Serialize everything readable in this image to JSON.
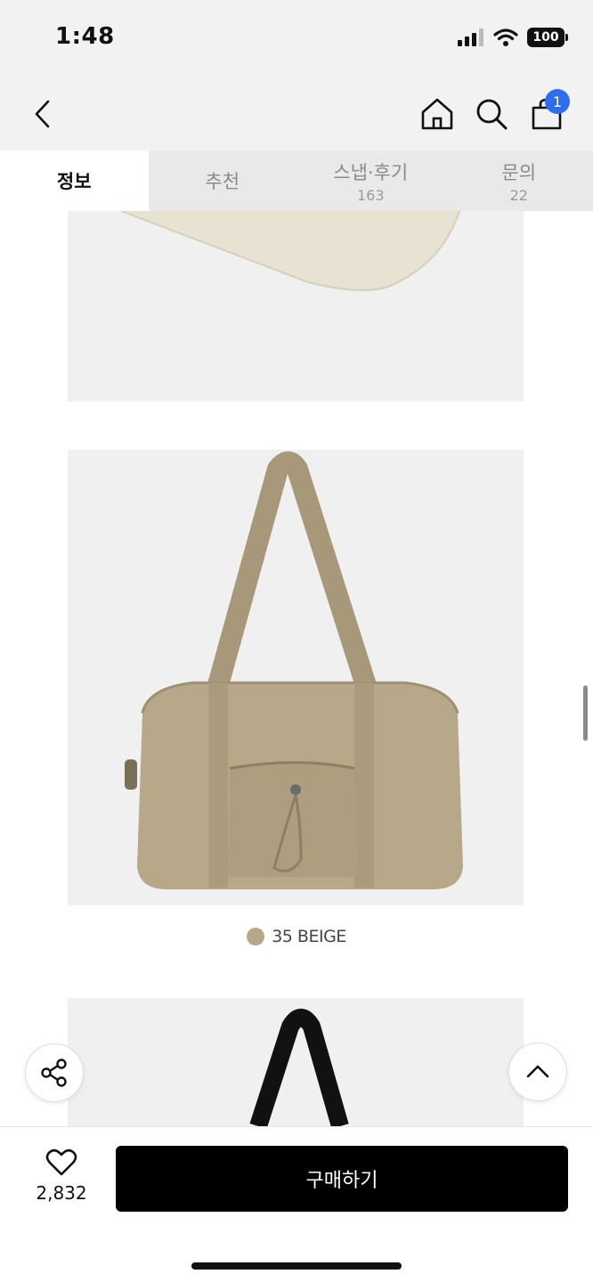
{
  "status": {
    "time": "1:48",
    "battery": "100"
  },
  "nav": {
    "cart_count": "1"
  },
  "tabs": [
    {
      "label": "정보",
      "count": ""
    },
    {
      "label": "추천",
      "count": ""
    },
    {
      "label": "스냅·후기",
      "count": "163"
    },
    {
      "label": "문의",
      "count": "22"
    }
  ],
  "product": {
    "color_label": "35 BEIGE",
    "color_swatch": "#b7a88a"
  },
  "actions": {
    "like_count": "2,832",
    "buy_label": "구매하기"
  },
  "colors": {
    "accent": "#2f6df0",
    "buy_button": "#000000",
    "header_bg": "#f2f2f2"
  }
}
